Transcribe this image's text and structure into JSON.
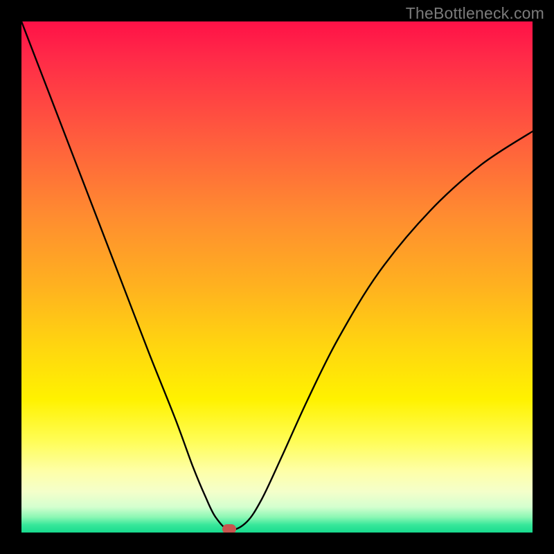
{
  "watermark": "TheBottleneck.com",
  "marker": {
    "x_frac": 0.407,
    "y_frac": 0.993,
    "color": "#c9554e"
  },
  "chart_data": {
    "type": "line",
    "title": "",
    "xlabel": "",
    "ylabel": "",
    "xlim": [
      0,
      1
    ],
    "ylim": [
      0,
      1
    ],
    "grid": false,
    "legend": false,
    "series": [
      {
        "name": "bottleneck-curve",
        "x": [
          0.0,
          0.05,
          0.1,
          0.15,
          0.2,
          0.25,
          0.3,
          0.335,
          0.36,
          0.38,
          0.407,
          0.44,
          0.47,
          0.51,
          0.56,
          0.62,
          0.7,
          0.8,
          0.9,
          1.0
        ],
        "y": [
          1.0,
          0.87,
          0.74,
          0.61,
          0.48,
          0.35,
          0.225,
          0.13,
          0.07,
          0.03,
          0.005,
          0.02,
          0.065,
          0.15,
          0.26,
          0.38,
          0.51,
          0.63,
          0.72,
          0.785
        ],
        "note": "y is measured from bottom (green) upward; curve is a V with minimum near x≈0.407"
      }
    ],
    "gradient_stops": [
      {
        "pos": 0.0,
        "color": "#ff1147"
      },
      {
        "pos": 0.22,
        "color": "#ff5a3e"
      },
      {
        "pos": 0.52,
        "color": "#ffb21f"
      },
      {
        "pos": 0.74,
        "color": "#fff200"
      },
      {
        "pos": 0.92,
        "color": "#f4ffca"
      },
      {
        "pos": 1.0,
        "color": "#18db8f"
      }
    ]
  }
}
